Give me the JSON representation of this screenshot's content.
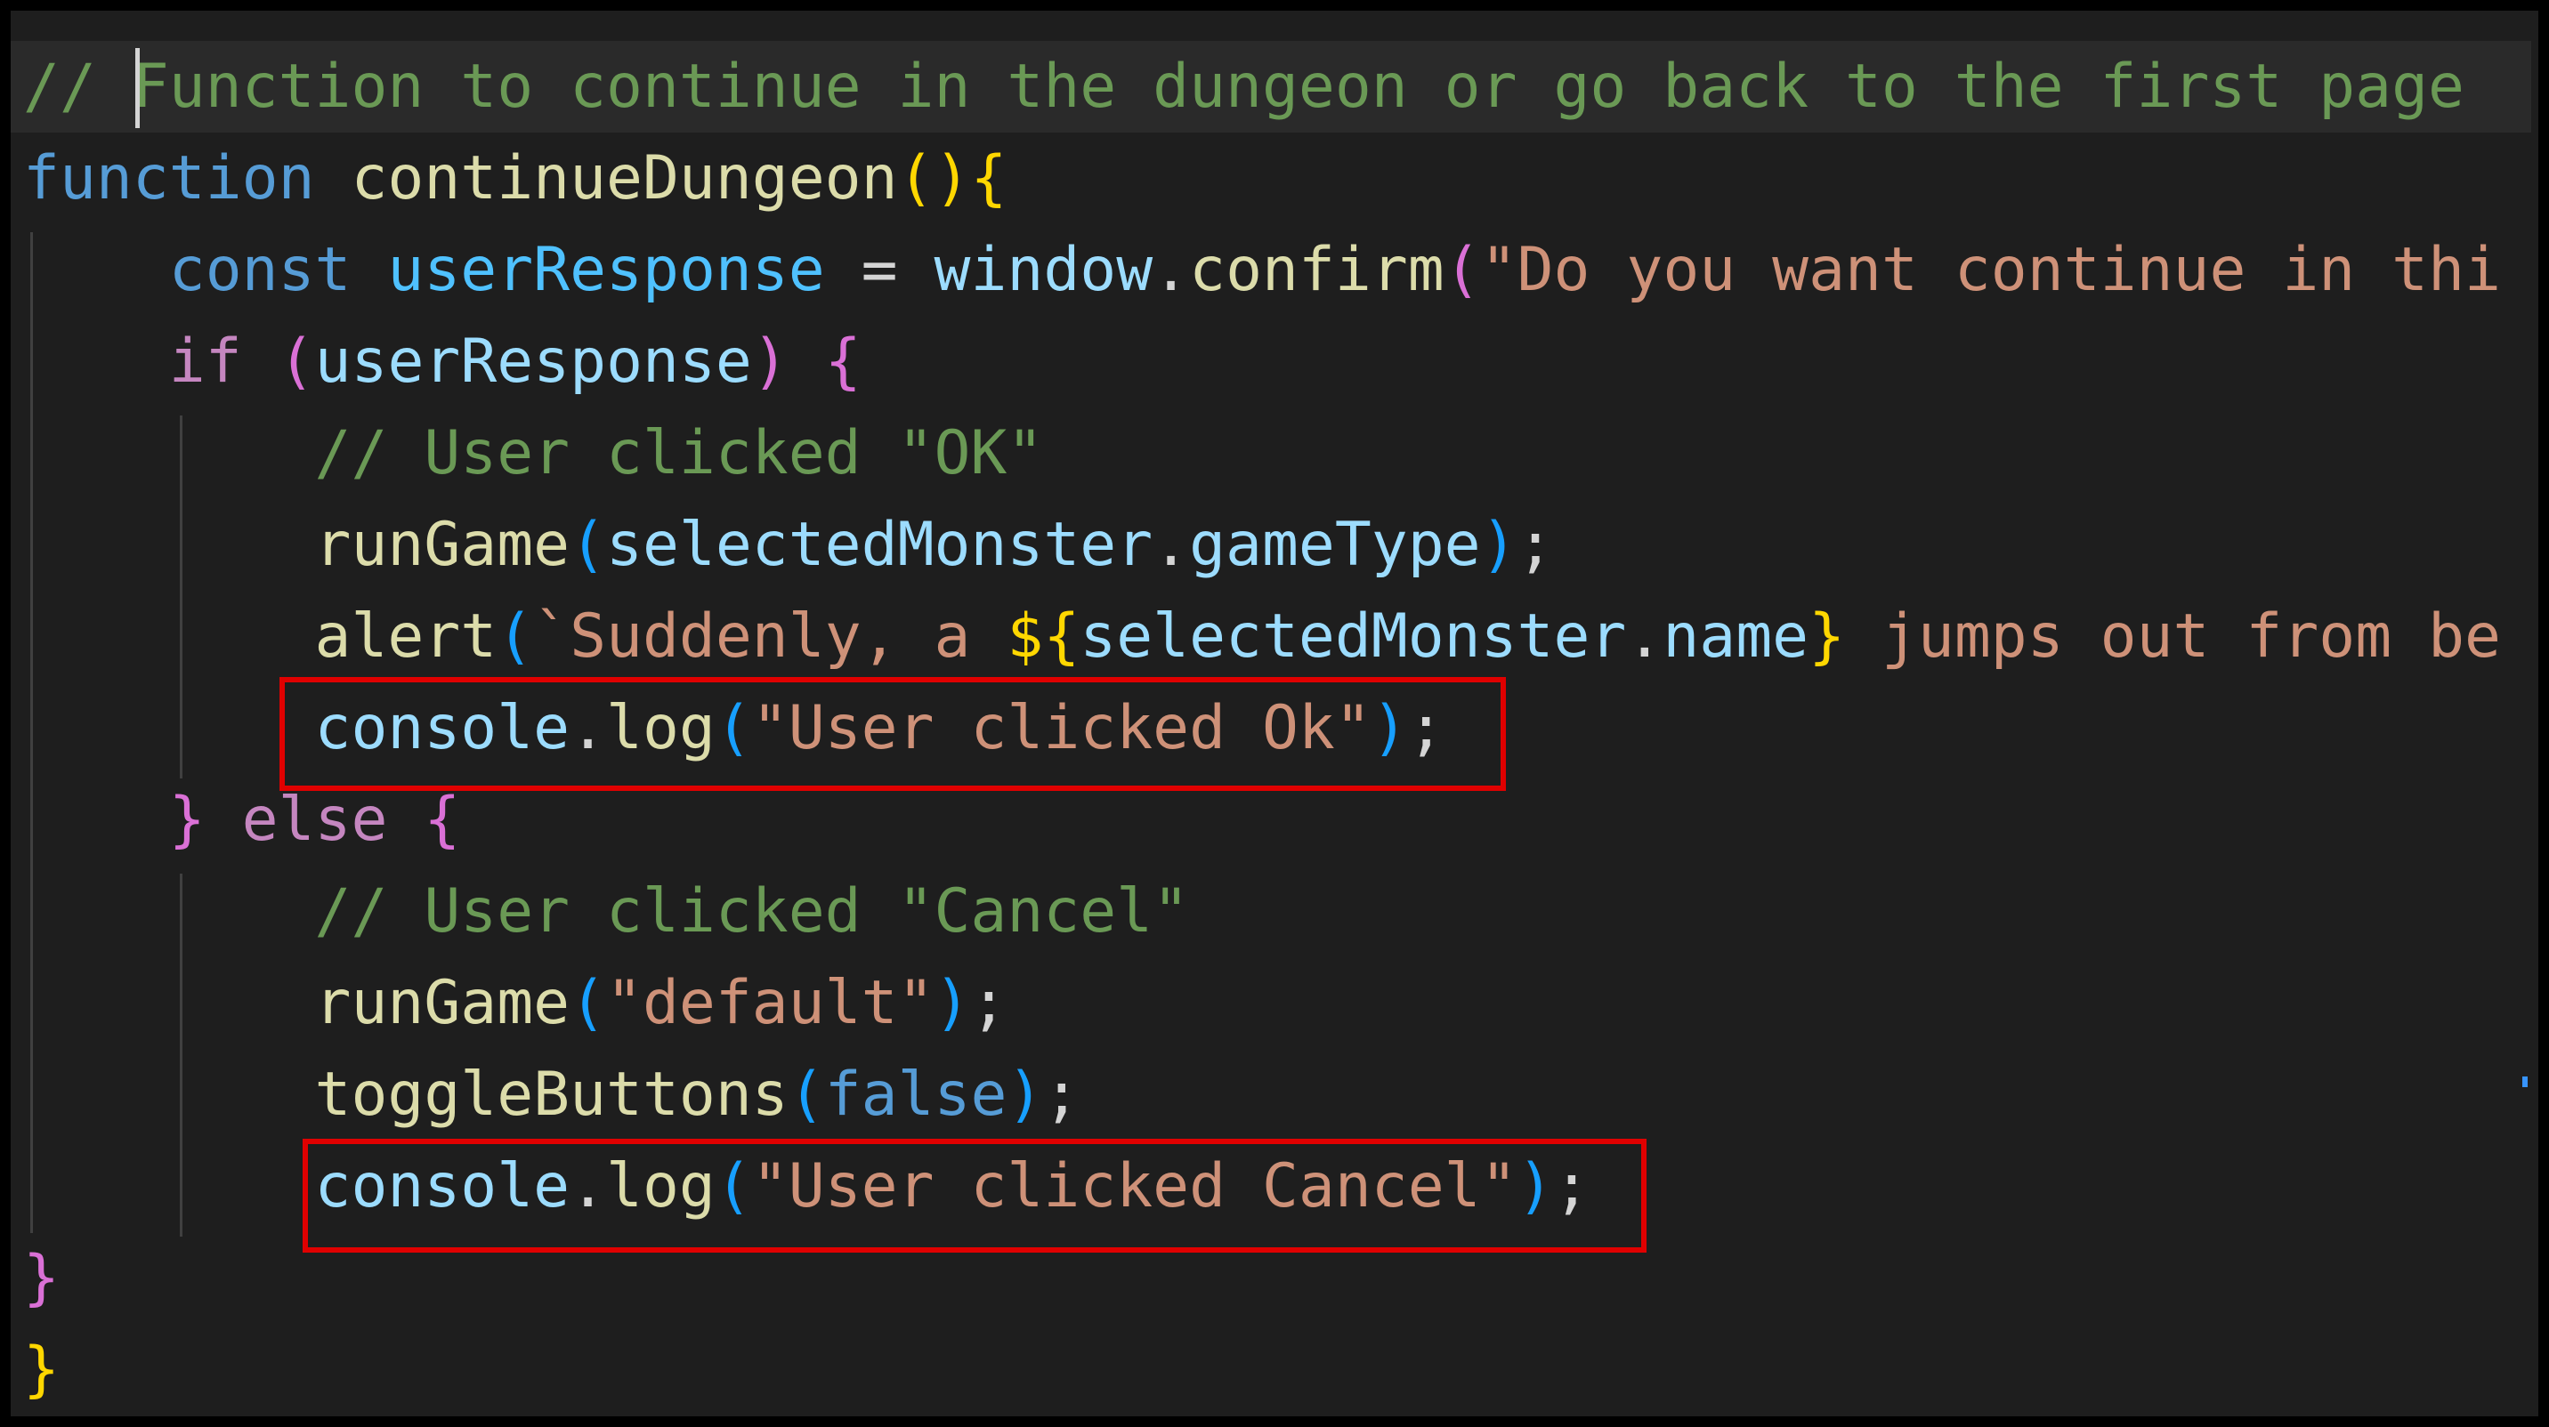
{
  "editor": {
    "lines": [
      {
        "tokens": [
          {
            "t": "// ",
            "c": "comment"
          },
          {
            "t": "Function to continue in the dungeon or go back to the first page",
            "c": "comment"
          }
        ]
      },
      {
        "tokens": [
          {
            "t": "function",
            "c": "keyword"
          },
          {
            "t": " ",
            "c": "op"
          },
          {
            "t": "continueDungeon",
            "c": "func"
          },
          {
            "t": "()",
            "c": "paren1"
          },
          {
            "t": "{",
            "c": "paren1"
          }
        ]
      },
      {
        "tokens": [
          {
            "t": "    ",
            "c": "op"
          },
          {
            "t": "const",
            "c": "keyword"
          },
          {
            "t": " ",
            "c": "op"
          },
          {
            "t": "userResponse",
            "c": "const"
          },
          {
            "t": " = ",
            "c": "op"
          },
          {
            "t": "window",
            "c": "var"
          },
          {
            "t": ".",
            "c": "op"
          },
          {
            "t": "confirm",
            "c": "func"
          },
          {
            "t": "(",
            "c": "paren2"
          },
          {
            "t": "\"Do you want continue in thi",
            "c": "string"
          }
        ]
      },
      {
        "tokens": [
          {
            "t": "    ",
            "c": "op"
          },
          {
            "t": "if",
            "c": "control"
          },
          {
            "t": " ",
            "c": "op"
          },
          {
            "t": "(",
            "c": "paren2"
          },
          {
            "t": "userResponse",
            "c": "var"
          },
          {
            "t": ")",
            "c": "paren2"
          },
          {
            "t": " ",
            "c": "op"
          },
          {
            "t": "{",
            "c": "paren2"
          }
        ]
      },
      {
        "tokens": [
          {
            "t": "        ",
            "c": "op"
          },
          {
            "t": "// User clicked \"OK\"",
            "c": "comment"
          }
        ]
      },
      {
        "tokens": [
          {
            "t": "        ",
            "c": "op"
          },
          {
            "t": "runGame",
            "c": "func"
          },
          {
            "t": "(",
            "c": "paren3"
          },
          {
            "t": "selectedMonster",
            "c": "var"
          },
          {
            "t": ".",
            "c": "op"
          },
          {
            "t": "gameType",
            "c": "var"
          },
          {
            "t": ")",
            "c": "paren3"
          },
          {
            "t": ";",
            "c": "op"
          }
        ]
      },
      {
        "tokens": [
          {
            "t": "        ",
            "c": "op"
          },
          {
            "t": "alert",
            "c": "func"
          },
          {
            "t": "(",
            "c": "paren3"
          },
          {
            "t": "`Suddenly, a ",
            "c": "string"
          },
          {
            "t": "${",
            "c": "paren1"
          },
          {
            "t": "selectedMonster",
            "c": "var"
          },
          {
            "t": ".",
            "c": "op"
          },
          {
            "t": "name",
            "c": "var"
          },
          {
            "t": "}",
            "c": "paren1"
          },
          {
            "t": " jumps out from be",
            "c": "string"
          }
        ]
      },
      {
        "tokens": [
          {
            "t": "        ",
            "c": "op"
          },
          {
            "t": "console",
            "c": "var"
          },
          {
            "t": ".",
            "c": "op"
          },
          {
            "t": "log",
            "c": "func"
          },
          {
            "t": "(",
            "c": "paren3"
          },
          {
            "t": "\"User clicked Ok\"",
            "c": "string"
          },
          {
            "t": ")",
            "c": "paren3"
          },
          {
            "t": ";",
            "c": "op"
          }
        ]
      },
      {
        "tokens": [
          {
            "t": "    ",
            "c": "op"
          },
          {
            "t": "}",
            "c": "paren2"
          },
          {
            "t": " ",
            "c": "op"
          },
          {
            "t": "else",
            "c": "control"
          },
          {
            "t": " ",
            "c": "op"
          },
          {
            "t": "{",
            "c": "paren2"
          }
        ]
      },
      {
        "tokens": [
          {
            "t": "        ",
            "c": "op"
          },
          {
            "t": "// User clicked \"Cancel\"",
            "c": "comment"
          }
        ]
      },
      {
        "tokens": [
          {
            "t": "        ",
            "c": "op"
          },
          {
            "t": "runGame",
            "c": "func"
          },
          {
            "t": "(",
            "c": "paren3"
          },
          {
            "t": "\"default\"",
            "c": "string"
          },
          {
            "t": ")",
            "c": "paren3"
          },
          {
            "t": ";",
            "c": "op"
          }
        ]
      },
      {
        "tokens": [
          {
            "t": "        ",
            "c": "op"
          },
          {
            "t": "toggleButtons",
            "c": "func"
          },
          {
            "t": "(",
            "c": "paren3"
          },
          {
            "t": "false",
            "c": "bool"
          },
          {
            "t": ")",
            "c": "paren3"
          },
          {
            "t": ";",
            "c": "op"
          }
        ]
      },
      {
        "tokens": [
          {
            "t": "        ",
            "c": "op"
          },
          {
            "t": "console",
            "c": "var"
          },
          {
            "t": ".",
            "c": "op"
          },
          {
            "t": "log",
            "c": "func"
          },
          {
            "t": "(",
            "c": "paren3"
          },
          {
            "t": "\"User clicked Cancel\"",
            "c": "string"
          },
          {
            "t": ")",
            "c": "paren3"
          },
          {
            "t": ";",
            "c": "op"
          }
        ]
      },
      {
        "tokens": [
          {
            "t": "}",
            "c": "paren2"
          }
        ]
      },
      {
        "tokens": [
          {
            "t": "}",
            "c": "paren1"
          }
        ]
      }
    ]
  },
  "annotations": {
    "color": "#e00000"
  },
  "colors": {
    "background": "#1e1e1e",
    "comment": "#6a9955",
    "keyword": "#569cd6",
    "control": "#c586c0",
    "function": "#dcdcaa",
    "variable": "#9cdcfe",
    "constant": "#4fc1ff",
    "string": "#ce9178",
    "bracket_level1": "#ffd700",
    "bracket_level2": "#da70d6",
    "bracket_level3": "#179fff"
  }
}
